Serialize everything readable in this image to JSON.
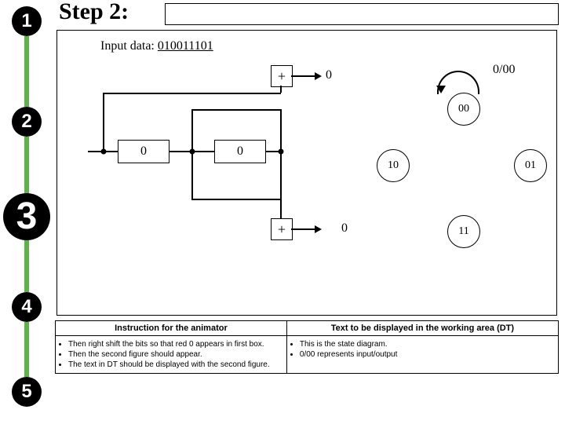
{
  "stepper": {
    "items": [
      "1",
      "2",
      "3",
      "4",
      "5"
    ],
    "current_index": 2
  },
  "title": "Step 2:",
  "input_label": "Input data:",
  "input_value": "010011101",
  "encoder": {
    "box_a": "0",
    "box_b": "0",
    "plus_top": "+",
    "plus_bottom": "+",
    "out_top": "0",
    "out_bottom": "0"
  },
  "io_label": "0/00",
  "states": {
    "s00": "00",
    "s10": "10",
    "s01": "01",
    "s11": "11"
  },
  "instructions_header_left": "Instruction for the animator",
  "instructions_header_right": "Text to be displayed in the working area (DT)",
  "instructions_left": [
    "Then right shift the bits so that red 0 appears in first box.",
    "Then the second figure should appear.",
    "The text in DT should be displayed with the second figure."
  ],
  "instructions_right": [
    "This is the state diagram.",
    "0/00 represents input/output"
  ]
}
